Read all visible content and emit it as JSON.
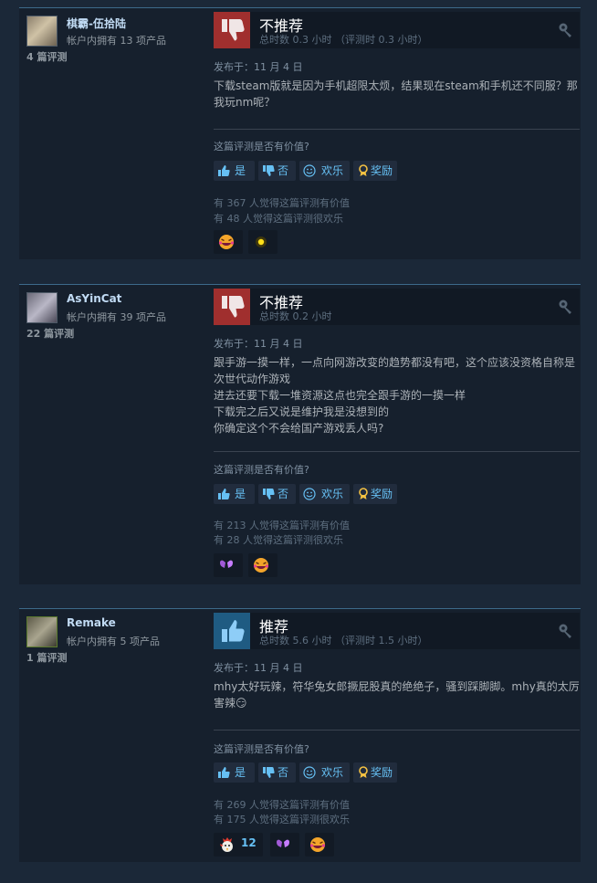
{
  "colors": {
    "page_bg": "#1b2838",
    "card_bg": "#16202d",
    "accent": "#66c0f4",
    "not_recommended": "#a02f2e",
    "recommended": "#1f5b82"
  },
  "reviews": [
    {
      "username": "棋霸-伍拾陆",
      "owned": "帐户内拥有 13 项产品",
      "review_count": "4 篇评测",
      "vote_title": "不推荐",
      "vote_icon": "thumbs-down-icon",
      "hours": "总时数 0.3 小时 （评测时 0.3 小时）",
      "posted": "发布于：11 月 4 日",
      "body": [
        "下载steam版就是因为手机超限太烦，结果现在steam和手机还不同服？那我玩nm呢？"
      ],
      "helpful_question": "这篇评测是否有价值?",
      "buttons": {
        "yes": "是",
        "no": "否",
        "funny": "欢乐",
        "award": "奖励"
      },
      "helpful_votes": "有 367 人觉得这篇评测有价值",
      "funny_votes": "有 48 人觉得这篇评测很欢乐",
      "awards": [
        {
          "icon": "laughing-face-award-icon",
          "count": ""
        },
        {
          "icon": "sparkle-award-icon",
          "count": ""
        }
      ]
    },
    {
      "username": "AsYinCat",
      "owned": "帐户内拥有 39 项产品",
      "review_count": "22 篇评测",
      "vote_title": "不推荐",
      "vote_icon": "thumbs-down-icon",
      "hours": "总时数 0.2 小时",
      "posted": "发布于：11 月 4 日",
      "body": [
        "跟手游一摸一样，一点向网游改变的趋势都没有吧，这个应该没资格自称是次世代动作游戏",
        "进去还要下载一堆资源这点也完全跟手游的一摸一样",
        "下载完之后又说是维护我是没想到的",
        "你确定这个不会给国产游戏丢人吗?"
      ],
      "helpful_question": "这篇评测是否有价值?",
      "buttons": {
        "yes": "是",
        "no": "否",
        "funny": "欢乐",
        "award": "奖励"
      },
      "helpful_votes": "有 213 人觉得这篇评测有价值",
      "funny_votes": "有 28 人觉得这篇评测很欢乐",
      "awards": [
        {
          "icon": "heart-award-icon",
          "count": ""
        },
        {
          "icon": "laughing-face-award-icon",
          "count": ""
        }
      ]
    },
    {
      "username": "Remake",
      "owned": "帐户内拥有 5 项产品",
      "review_count": "1 篇评测",
      "vote_title": "推荐",
      "vote_icon": "thumbs-up-icon",
      "hours": "总时数 5.6 小时 （评测时 1.5 小时）",
      "posted": "发布于：11 月 4 日",
      "body": [
        "mhy太好玩辣，符华兔女郎撅屁股真的绝绝子，骚到踩脚脚。mhy真的太厉害辣😏"
      ],
      "helpful_question": "这篇评测是否有价值?",
      "buttons": {
        "yes": "是",
        "no": "否",
        "funny": "欢乐",
        "award": "奖励"
      },
      "helpful_votes": "有 269 人觉得这篇评测有价值",
      "funny_votes": "有 175 人觉得这篇评测很欢乐",
      "awards": [
        {
          "icon": "rooster-award-icon",
          "count": "12"
        },
        {
          "icon": "heart-award-icon",
          "count": ""
        },
        {
          "icon": "laughing-face-award-icon",
          "count": ""
        }
      ]
    }
  ]
}
